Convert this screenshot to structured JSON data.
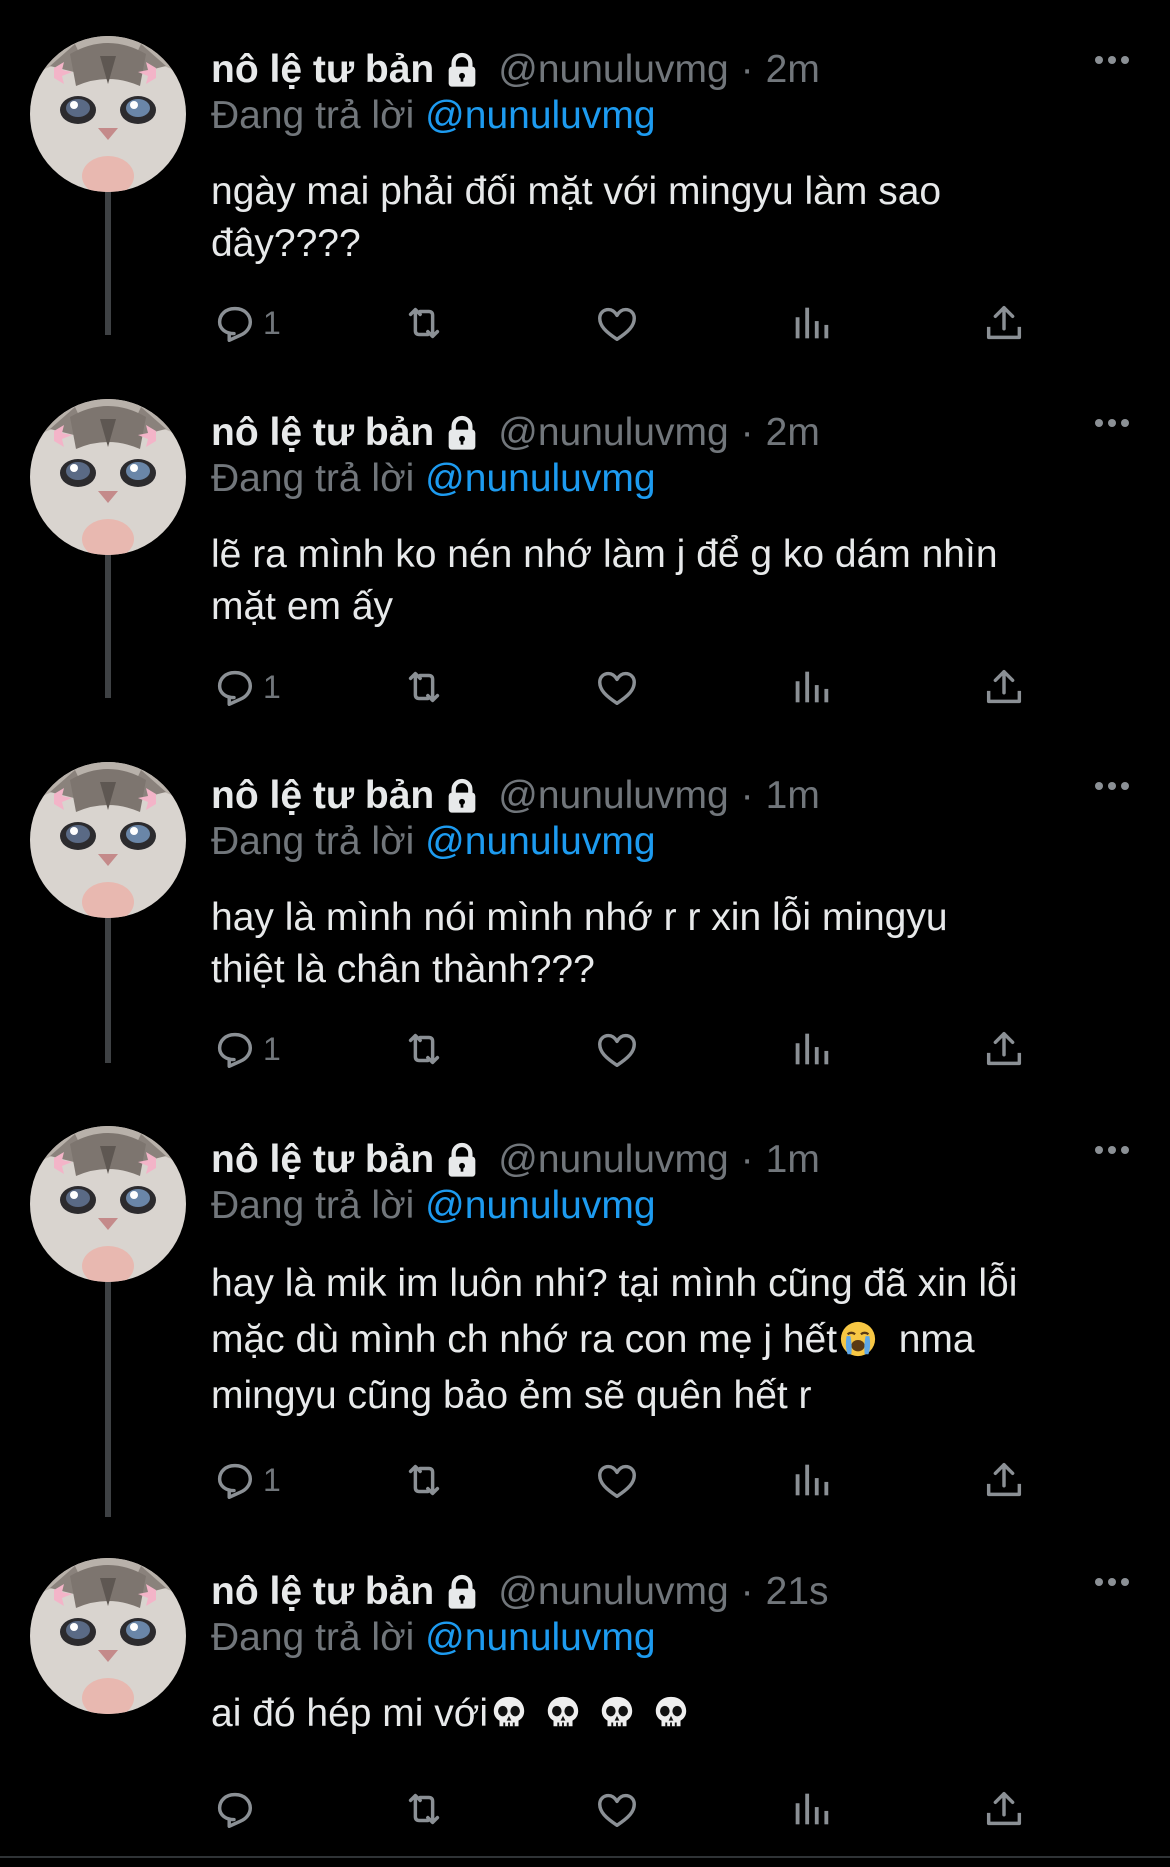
{
  "colors": {
    "background": "#000000",
    "text": "#e7e9ea",
    "muted": "#71767b",
    "link": "#1d9bf0"
  },
  "tweets": [
    {
      "name": "nô lệ tư bản",
      "handle": "@nunuluvmg",
      "separator": "·",
      "time": "2m",
      "replying_prefix": "Đang trả lời",
      "replying_to": "@nunuluvmg",
      "lines": [
        "ngày mai phải đối mặt với mingyu làm sao",
        "đây????"
      ],
      "reply_count": "1"
    },
    {
      "name": "nô lệ tư bản",
      "handle": "@nunuluvmg",
      "separator": "·",
      "time": "2m",
      "replying_prefix": "Đang trả lời",
      "replying_to": "@nunuluvmg",
      "lines": [
        "lẽ ra mình ko nén nhớ làm j để g ko dám nhìn",
        "mặt em ấy"
      ],
      "reply_count": "1"
    },
    {
      "name": "nô lệ tư bản",
      "handle": "@nunuluvmg",
      "separator": "·",
      "time": "1m",
      "replying_prefix": "Đang trả lời",
      "replying_to": "@nunuluvmg",
      "lines": [
        "hay là mình nói mình nhớ r r xin lỗi mingyu",
        "thiệt là chân thành???"
      ],
      "reply_count": "1"
    },
    {
      "name": "nô lệ tư bản",
      "handle": "@nunuluvmg",
      "separator": "·",
      "time": "1m",
      "replying_prefix": "Đang trả lời",
      "replying_to": "@nunuluvmg",
      "lines": [
        "hay là mik im luôn nhi? tại mình cũng đã xin lỗi",
        "mặc dù mình ch nhớ ra con mẹ j hết",
        "  nma",
        "mingyu cũng bảo ẻm sẽ quên hết r"
      ],
      "reply_count": "1"
    },
    {
      "name": "nô lệ tư bản",
      "handle": "@nunuluvmg",
      "separator": "·",
      "time": "21s",
      "replying_prefix": "Đang trả lời",
      "replying_to": "@nunuluvmg",
      "lines": [
        "ai đó hép mi với"
      ],
      "reply_count": ""
    }
  ],
  "icons": [
    "reply-icon",
    "retweet-icon",
    "like-icon",
    "views-icon",
    "share-icon",
    "lock-icon",
    "more-icon",
    "crying-face-emoji",
    "skull-emoji"
  ]
}
